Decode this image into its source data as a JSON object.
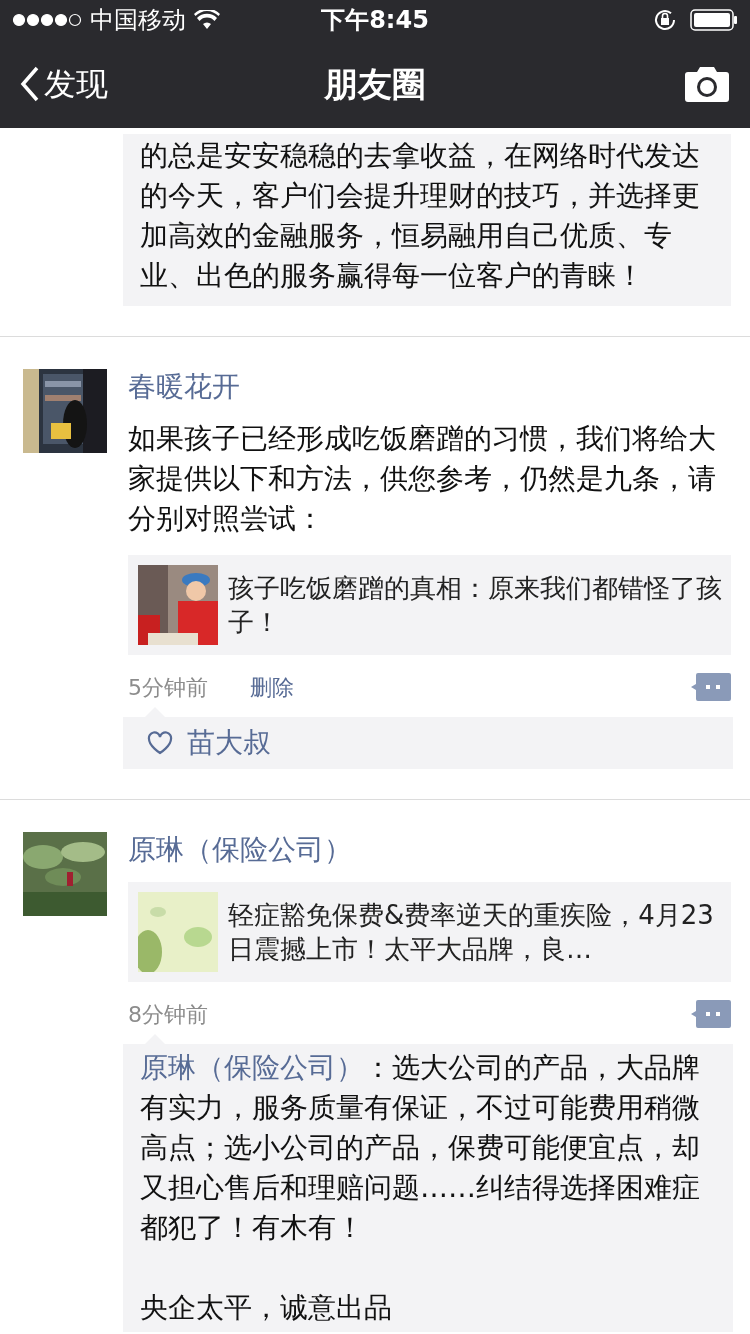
{
  "status_bar": {
    "carrier": "中国移动",
    "time": "下午8:45"
  },
  "nav": {
    "back": "发现",
    "title": "朋友圈"
  },
  "top_comment": {
    "text": "的总是安安稳稳的去拿收益，在网络时代发达的今天，客户们会提升理财的技巧，并选择更加高效的金融服务，恒易融用自己优质、专业、出色的服务赢得每一位客户的青睐！"
  },
  "posts": [
    {
      "author": "春暖花开",
      "text": "如果孩子已经形成吃饭磨蹭的习惯，我们将给大家提供以下和方法，供您参考，仍然是九条，请分别对照尝试：",
      "link": {
        "title": "孩子吃饭磨蹭的真相：原来我们都错怪了孩子！"
      },
      "time": "5分钟前",
      "delete": "删除",
      "likes": [
        "苗大叔"
      ]
    },
    {
      "author": "原琳（保险公司）",
      "link": {
        "title": "轻症豁免保费&费率逆天的重疾险，4月23日震撼上市！太平大品牌，良…"
      },
      "time": "8分钟前",
      "comments": [
        {
          "author": "原琳（保险公司）",
          "paragraphs": [
            "：选大公司的产品，大品牌有实力，服务质量有保证，不过可能费用稍微高点；选小公司的产品，保费可能便宜点，却又担心售后和理赔问题……纠结得选择困难症都犯了！有木有！",
            "央企太平，诚意出品"
          ]
        }
      ]
    }
  ]
}
